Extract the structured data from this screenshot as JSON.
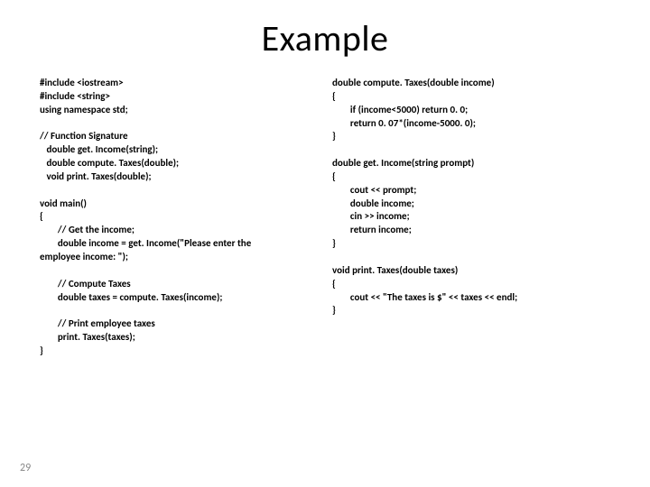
{
  "title": "Example",
  "left_code": "#include <iostream>\n#include <string>\nusing namespace std;\n\n// Function Signature\n   double get. Income(string);\n   double compute. Taxes(double);\n   void print. Taxes(double);\n\nvoid main()\n{\n        // Get the income;\n        double income = get. Income(\"Please enter the\nemployee income: \");\n\n        // Compute Taxes\n        double taxes = compute. Taxes(income);\n\n        // Print employee taxes\n        print. Taxes(taxes);\n}",
  "right_code": "double compute. Taxes(double income)\n{\n        if (income<5000) return 0. 0;\n        return 0. 07*(income-5000. 0);\n}\n\ndouble get. Income(string prompt)\n{\n        cout << prompt;\n        double income;\n        cin >> income;\n        return income;\n}\n\nvoid print. Taxes(double taxes)\n{\n        cout << \"The taxes is $\" << taxes << endl;\n}",
  "page_number": "29"
}
